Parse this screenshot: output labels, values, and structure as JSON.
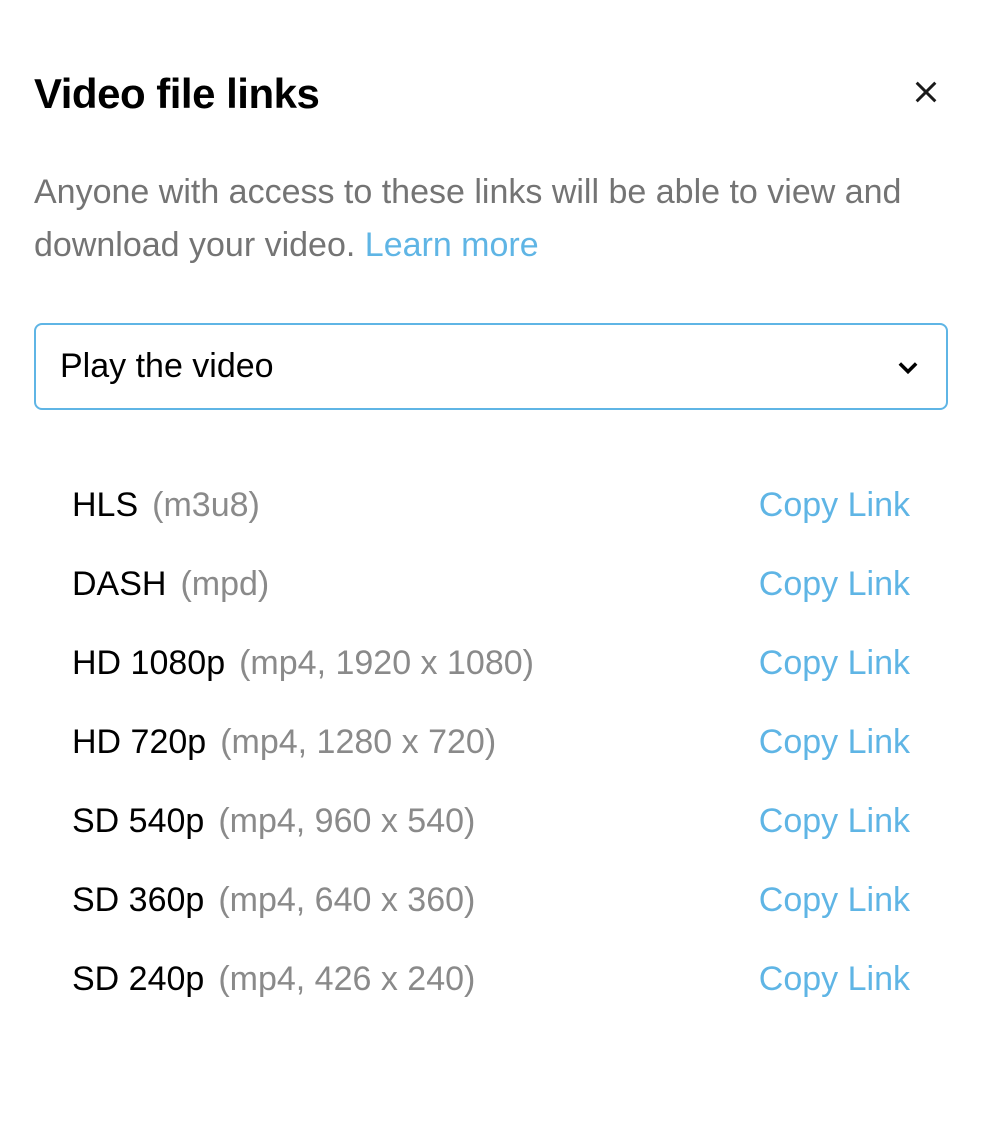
{
  "header": {
    "title": "Video file links"
  },
  "description": {
    "text": "Anyone with access to these links will be able to view and download your video.",
    "learn_more": "Learn more"
  },
  "select": {
    "value": "Play the video"
  },
  "copy_label": "Copy Link",
  "links": [
    {
      "name": "HLS",
      "format": "(m3u8)"
    },
    {
      "name": "DASH",
      "format": "(mpd)"
    },
    {
      "name": "HD 1080p",
      "format": "(mp4, 1920 x 1080)"
    },
    {
      "name": "HD 720p",
      "format": "(mp4, 1280 x 720)"
    },
    {
      "name": "SD 540p",
      "format": "(mp4, 960 x 540)"
    },
    {
      "name": "SD 360p",
      "format": "(mp4, 640 x 360)"
    },
    {
      "name": "SD 240p",
      "format": "(mp4, 426 x 240)"
    }
  ]
}
